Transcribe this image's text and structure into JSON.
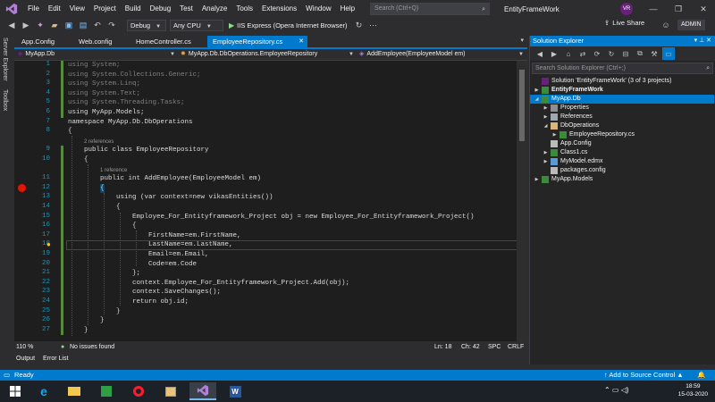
{
  "menu": {
    "items": [
      "File",
      "Edit",
      "View",
      "Project",
      "Build",
      "Debug",
      "Test",
      "Analyze",
      "Tools",
      "Extensions",
      "Window",
      "Help"
    ],
    "search_placeholder": "Search (Ctrl+Q)",
    "solution_title": "EntityFrameWork",
    "avatar_initials": "VR"
  },
  "toolbar": {
    "config": "Debug",
    "platform": "Any CPU",
    "run_label": "IIS Express (Opera Internet Browser)",
    "live_share": "Live Share",
    "admin": "ADMIN"
  },
  "left_strip": {
    "server_explorer": "Server Explorer",
    "toolbox": "Toolbox"
  },
  "doc_tabs": [
    {
      "label": "App.Config",
      "active": false
    },
    {
      "label": "Web.config",
      "active": false
    },
    {
      "label": "HomeController.cs",
      "active": false
    },
    {
      "label": "EmployeeRepository.cs",
      "active": true
    }
  ],
  "navbar": {
    "project": "MyApp.Db",
    "class": "MyApp.Db.DbOperations.EmployeeRepository",
    "member": "AddEmployee(EmployeeModel em)"
  },
  "editor": {
    "line_numbers": [
      "1",
      "2",
      "3",
      "4",
      "5",
      "6",
      "7",
      "8",
      "9",
      "10",
      "11",
      "12",
      "13",
      "14",
      "15",
      "16",
      "17",
      "18",
      "19",
      "20",
      "21",
      "22",
      "23",
      "24",
      "25",
      "26",
      "27"
    ],
    "ref_2": "2 references",
    "ref_1": "1 reference",
    "lines": {
      "l1": "using System;",
      "l2": "using System.Collections.Generic;",
      "l3": "using System.Linq;",
      "l4": "using System.Text;",
      "l5": "using System.Threading.Tasks;",
      "l6": "using MyApp.Models;",
      "l7": "namespace MyApp.Db.DbOperations",
      "l8": "{",
      "l9": "public class EmployeeRepository",
      "l10": "{",
      "l11": "public int AddEmployee(EmployeeModel em)",
      "l12": "{",
      "l13": "using (var context=new vikasEntities())",
      "l14": "{",
      "l15": "Employee_For_Entityframework_Project obj = new Employee_For_Entityframework_Project()",
      "l16": "{",
      "l17": "FirstName=em.FirstName,",
      "l18": "LastName=em.LastName,",
      "l19": "Email=em.Email,",
      "l20": "Code=em.Code",
      "l21": "};",
      "l22": "context.Employee_For_Entityframework_Project.Add(obj);",
      "l23": "context.SaveChanges();",
      "l24": "return obj.id;",
      "l25": "}",
      "l26": "}",
      "l27": "}"
    }
  },
  "editor_status": {
    "zoom": "110 %",
    "issues": "No issues found",
    "ln": "Ln: 18",
    "ch": "Ch: 42",
    "spc": "SPC",
    "crlf": "CRLF"
  },
  "output_tabs": [
    "Output",
    "Error List"
  ],
  "solution_explorer": {
    "title": "Solution Explorer",
    "search_placeholder": "Search Solution Explorer (Ctrl+;)",
    "items": [
      {
        "label": "Solution 'EntityFrameWork' (3 of 3 projects)"
      },
      {
        "label": "EntityFrameWork"
      },
      {
        "label": "MyApp.Db"
      },
      {
        "label": "Properties"
      },
      {
        "label": "References"
      },
      {
        "label": "DbOperations"
      },
      {
        "label": "EmployeeRepository.cs"
      },
      {
        "label": "App.Config"
      },
      {
        "label": "Class1.cs"
      },
      {
        "label": "MyModel.edmx"
      },
      {
        "label": "packages.config"
      },
      {
        "label": "MyApp.Models"
      }
    ]
  },
  "statusbar": {
    "ready": "Ready",
    "source_control": "Add to Source Control"
  },
  "taskbar": {
    "time": "18:59",
    "date": "15-03-2020"
  },
  "colors": {
    "accent": "#007acc",
    "editor_bg": "#1e1e1e",
    "keyword": "#569cd6",
    "type": "#4ec9b0",
    "breakpoint": "#e51400"
  }
}
